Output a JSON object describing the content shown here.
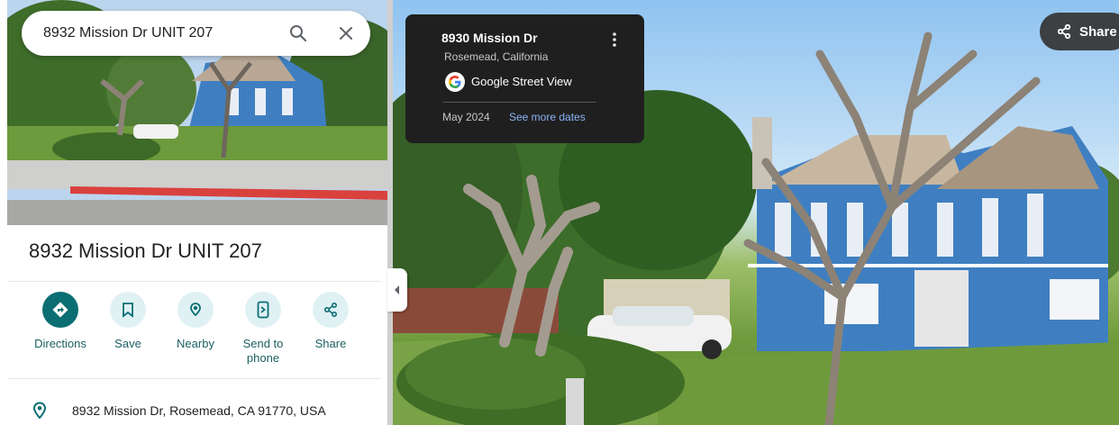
{
  "search": {
    "query": "8932 Mission Dr UNIT 207",
    "search_icon": "search-icon",
    "close_icon": "close-icon"
  },
  "place": {
    "title": "8932 Mission Dr UNIT 207",
    "address": "8932 Mission Dr, Rosemead, CA 91770, USA"
  },
  "actions": [
    {
      "label": "Directions",
      "icon": "directions-icon"
    },
    {
      "label": "Save",
      "icon": "bookmark-icon"
    },
    {
      "label": "Nearby",
      "icon": "nearby-icon"
    },
    {
      "label": "Send to phone",
      "icon": "send-to-phone-icon"
    },
    {
      "label": "Share",
      "icon": "share-icon"
    }
  ],
  "street_view": {
    "title": "8930 Mission Dr",
    "subtitle": "Rosemead, California",
    "provider": "Google Street View",
    "date": "May 2024",
    "see_more": "See more dates",
    "share_label": "Share"
  },
  "colors": {
    "accent": "#0b6e73",
    "accent_light": "#e0f1f4",
    "card_bg": "#1f1f1f",
    "link_blue": "#8ab4f8"
  }
}
